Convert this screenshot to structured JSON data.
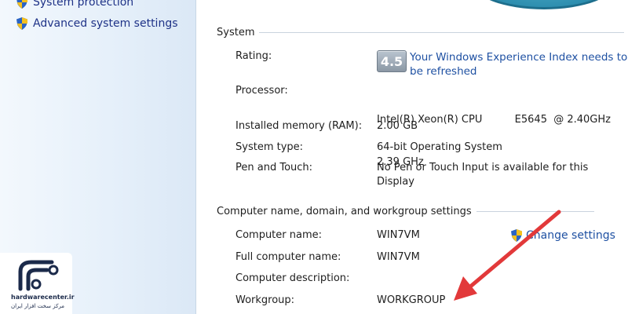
{
  "sidebar": {
    "links": [
      {
        "label": "System protection"
      },
      {
        "label": "Advanced system settings"
      }
    ]
  },
  "system": {
    "heading": "System",
    "rating": {
      "label": "Rating:",
      "score": "4.5",
      "link_line1": "Your Windows Experience Index needs to",
      "link_line2": "be refreshed"
    },
    "processor": {
      "label": "Processor:",
      "value_line1": "Intel(R) Xeon(R) CPU          E5645  @ 2.40GHz",
      "value_line2": "2.39 GHz"
    },
    "memory": {
      "label": "Installed memory (RAM):",
      "value": "2.00 GB"
    },
    "system_type": {
      "label": "System type:",
      "value": "64-bit Operating System"
    },
    "pen_touch": {
      "label": "Pen and Touch:",
      "value_line1": "No Pen or Touch Input is available for this",
      "value_line2": "Display"
    }
  },
  "computer_name": {
    "heading": "Computer name, domain, and workgroup settings",
    "change_label": "Change settings",
    "name": {
      "label": "Computer name:",
      "value": "WIN7VM"
    },
    "full_name": {
      "label": "Full computer name:",
      "value": "WIN7VM"
    },
    "description": {
      "label": "Computer description:",
      "value": ""
    },
    "workgroup": {
      "label": "Workgroup:",
      "value": "WORKGROUP"
    }
  },
  "watermark": {
    "domain": "hardwarecenter.ir",
    "subtitle": "مرکز سخت افزار ایران"
  },
  "colors": {
    "link": "#1e50a2",
    "arrow": "#e2393a",
    "sidebar_bg": "#e6f0fa"
  }
}
